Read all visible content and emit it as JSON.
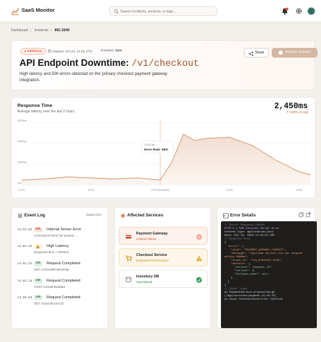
{
  "app": {
    "title": "SaaS Monitor"
  },
  "search": {
    "placeholder": "Search incidents, services, or logs..."
  },
  "breadcrumb": [
    "Dashboard",
    "Incidents",
    "INC-2040"
  ],
  "incident": {
    "severity": "CRITICAL",
    "started": "Started: Oct 24, 14:02 UTC",
    "duration_label": "Duration:",
    "duration_value": "43m",
    "title_prefix": "API Endpoint Downtime:",
    "title_path": "/v1/checkout",
    "description": "High latency and 500 errors detected on the primary checkout payment gateway integration.",
    "share_label": "Share",
    "resolve_label": "Resolve Incident"
  },
  "response_time": {
    "title": "Response Time",
    "subtitle": "Average latency over the last 2 hours",
    "value": "2,450ms",
    "change": "↗ +420% vs avg"
  },
  "chart_data": {
    "type": "area",
    "title": "Response Time",
    "subtitle": "Average latency over the last 2 hours",
    "y_labels": [
      "3000ms",
      "2000ms",
      "1000ms",
      "0ms"
    ],
    "ylim": [
      0,
      3000
    ],
    "x_labels": [
      "12:00",
      "12:30",
      "13:00 (Incident)",
      "13:30",
      "14:00"
    ],
    "x": [
      0,
      10,
      20,
      30,
      40,
      50,
      60,
      65,
      70,
      75,
      80,
      90,
      100,
      110,
      120,
      125
    ],
    "values": [
      250,
      300,
      400,
      350,
      300,
      350,
      250,
      1100,
      2450,
      2150,
      2250,
      2300,
      1900,
      1200,
      650,
      500
    ],
    "incident_marker_x": 60,
    "tooltip": {
      "time": "13:02:45",
      "label": "Error Rate: 85%"
    },
    "color": "#d4a888",
    "grid": true
  },
  "event_log": {
    "title": "Event Log",
    "export_label": "Export CSV",
    "items": [
      {
        "time": "14:03:02",
        "code": "500",
        "name": "Internal Server Error",
        "detail": "Connection timed out upstrea..."
      },
      {
        "time": "14:02:45",
        "code": "",
        "name": "High Latency",
        "detail": "Response time > 2000ms"
      },
      {
        "time": "14:01:22",
        "code": "200",
        "name": "Request Completed",
        "detail": "GET /v1/health/status/http"
      },
      {
        "time": "14:01:15",
        "code": "200",
        "name": "Request Completed",
        "detail": "POST /v1/auth/validate"
      },
      {
        "time": "14:00:58",
        "code": "200",
        "name": "Request Completed",
        "detail": "GET /v1/products/723"
      }
    ]
  },
  "services": {
    "title": "Affected Services",
    "items": [
      {
        "name": "Payment Gateway",
        "status": "Critical Failure",
        "color": "#d2542a"
      },
      {
        "name": "Checkout Service",
        "status": "Degraded Performance",
        "color": "#c98a14"
      },
      {
        "name": "Inventory DB",
        "status": "Operational",
        "color": "#2e8a4e"
      }
    ]
  },
  "error_details": {
    "title": "Error Details",
    "lines": [
      "// Server Response Header",
      "HTTP/1.1 500 Internal Server Error",
      "Content-Type: application/json",
      "Date: Oct 24, 2023 14:03:01 GMT",
      "",
      "// Response Body",
      "{",
      "  \"error\": {",
      "    \"code\": \"PAYMENT_GATEWAY_TIMEOUT\",",
      "    \"message\": \"Upstream service did not respond",
      "within 5000ms\",",
      "    \"trace_id\": \"req_9f82e3c1-9c3d\",",
      "    \"details\": {",
      "      \"service\": \"payment-v2\",",
      "      \"retries\": 3,",
      "      \"fallback_mode\": null",
      "    }",
      "  }",
      "}",
      "",
      "// Stack Trace",
      "at PaymentService.processCharge",
      "(/app/services/payment.ts:42:15)",
      "at async CheckoutController.finalize"
    ]
  }
}
